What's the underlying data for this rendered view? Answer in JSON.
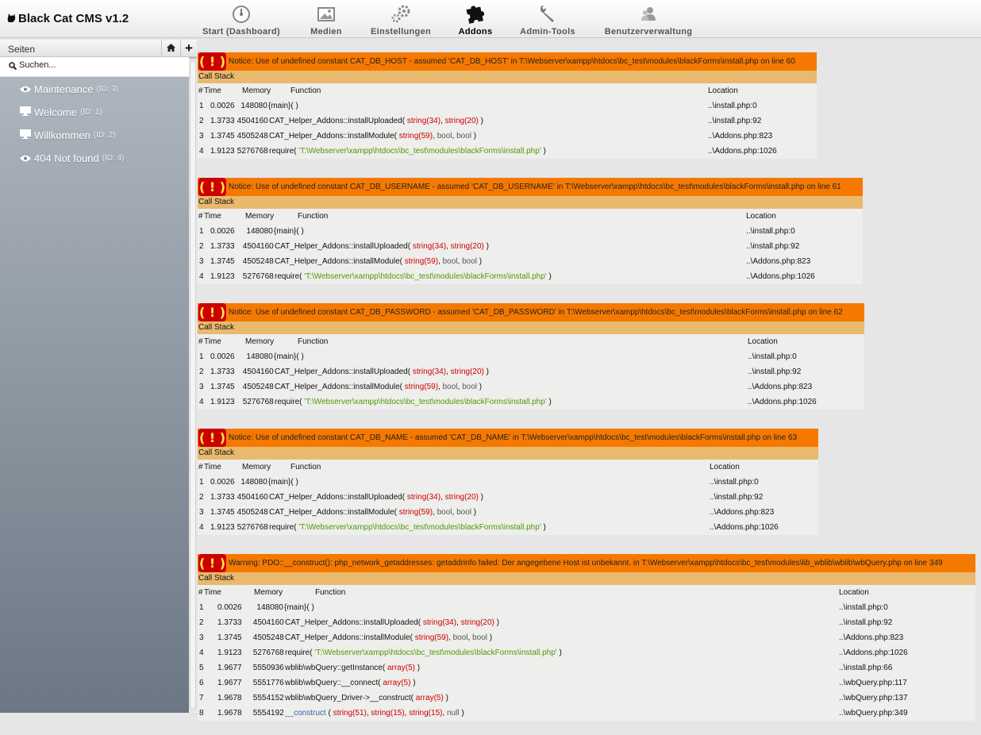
{
  "app": {
    "title": "Black Cat CMS v1.2"
  },
  "nav": [
    {
      "label": "Start (Dashboard)",
      "icon": "dashboard-icon"
    },
    {
      "label": "Medien",
      "icon": "media-icon"
    },
    {
      "label": "Einstellungen",
      "icon": "gears-icon"
    },
    {
      "label": "Addons",
      "icon": "puzzle-icon",
      "active": true
    },
    {
      "label": "Admin-Tools",
      "icon": "wrench-icon"
    },
    {
      "label": "Benutzerverwaltung",
      "icon": "users-icon"
    }
  ],
  "sidebar": {
    "title": "Seiten",
    "search_placeholder": "Suchen...",
    "pages": [
      {
        "name": "Maintenance",
        "id": "(ID: 3)",
        "icon": "eye-icon"
      },
      {
        "name": "Welcome",
        "id": "(ID: 1)",
        "icon": "monitor-icon"
      },
      {
        "name": "Willkommen",
        "id": "(ID: 2)",
        "icon": "monitor-icon"
      },
      {
        "name": "404 Not found",
        "id": "(ID: 4)",
        "icon": "eye-icon"
      }
    ]
  },
  "errors": {
    "call_stack_label": "Call Stack",
    "col_num": "#",
    "col_time": "Time",
    "col_memory": "Memory",
    "col_function": "Function",
    "col_location": "Location",
    "bang": "( ! )",
    "blocks": [
      {
        "message": "Notice: Use of undefined constant CAT_DB_HOST - assumed 'CAT_DB_HOST' in T:\\Webserver\\xampp\\htdocs\\bc_test\\modules\\blackForms\\install.php on line 60",
        "rows": [
          {
            "n": "1",
            "time": "0.0026",
            "mem": "148080",
            "func": "{main}( )",
            "loc": "..\\install.php:0"
          },
          {
            "n": "2",
            "time": "1.3733",
            "mem": "4504160",
            "func": "CAT_Helper_Addons::installUploaded( string(34), string(20) )",
            "loc": "..\\install.php:92"
          },
          {
            "n": "3",
            "time": "1.3745",
            "mem": "4505248",
            "func": "CAT_Helper_Addons::installModule( string(59), bool, bool )",
            "loc": "..\\Addons.php:823"
          },
          {
            "n": "4",
            "time": "1.9123",
            "mem": "5276768",
            "func": "require( 'T:\\Webserver\\xampp\\htdocs\\bc_test\\modules\\blackForms\\install.php' )",
            "loc": "..\\Addons.php:1026"
          }
        ]
      },
      {
        "message": "Notice: Use of undefined constant CAT_DB_USERNAME - assumed 'CAT_DB_USERNAME' in T:\\Webserver\\xampp\\htdocs\\bc_test\\modules\\blackForms\\install.php on line 61",
        "rows": [
          {
            "n": "1",
            "time": "0.0026",
            "mem": "148080",
            "func": "{main}( )",
            "loc": "..\\install.php:0"
          },
          {
            "n": "2",
            "time": "1.3733",
            "mem": "4504160",
            "func": "CAT_Helper_Addons::installUploaded( string(34), string(20) )",
            "loc": "..\\install.php:92"
          },
          {
            "n": "3",
            "time": "1.3745",
            "mem": "4505248",
            "func": "CAT_Helper_Addons::installModule( string(59), bool, bool )",
            "loc": "..\\Addons.php:823"
          },
          {
            "n": "4",
            "time": "1.9123",
            "mem": "5276768",
            "func": "require( 'T:\\Webserver\\xampp\\htdocs\\bc_test\\modules\\blackForms\\install.php' )",
            "loc": "..\\Addons.php:1026"
          }
        ]
      },
      {
        "message": "Notice: Use of undefined constant CAT_DB_PASSWORD - assumed 'CAT_DB_PASSWORD' in T:\\Webserver\\xampp\\htdocs\\bc_test\\modules\\blackForms\\install.php on line 62",
        "rows": [
          {
            "n": "1",
            "time": "0.0026",
            "mem": "148080",
            "func": "{main}( )",
            "loc": "..\\install.php:0"
          },
          {
            "n": "2",
            "time": "1.3733",
            "mem": "4504160",
            "func": "CAT_Helper_Addons::installUploaded( string(34), string(20) )",
            "loc": "..\\install.php:92"
          },
          {
            "n": "3",
            "time": "1.3745",
            "mem": "4505248",
            "func": "CAT_Helper_Addons::installModule( string(59), bool, bool )",
            "loc": "..\\Addons.php:823"
          },
          {
            "n": "4",
            "time": "1.9123",
            "mem": "5276768",
            "func": "require( 'T:\\Webserver\\xampp\\htdocs\\bc_test\\modules\\blackForms\\install.php' )",
            "loc": "..\\Addons.php:1026"
          }
        ]
      },
      {
        "message": "Notice: Use of undefined constant CAT_DB_NAME - assumed 'CAT_DB_NAME' in T:\\Webserver\\xampp\\htdocs\\bc_test\\modules\\blackForms\\install.php on line 63",
        "rows": [
          {
            "n": "1",
            "time": "0.0026",
            "mem": "148080",
            "func": "{main}( )",
            "loc": "..\\install.php:0"
          },
          {
            "n": "2",
            "time": "1.3733",
            "mem": "4504160",
            "func": "CAT_Helper_Addons::installUploaded( string(34), string(20) )",
            "loc": "..\\install.php:92"
          },
          {
            "n": "3",
            "time": "1.3745",
            "mem": "4505248",
            "func": "CAT_Helper_Addons::installModule( string(59), bool, bool )",
            "loc": "..\\Addons.php:823"
          },
          {
            "n": "4",
            "time": "1.9123",
            "mem": "5276768",
            "func": "require( 'T:\\Webserver\\xampp\\htdocs\\bc_test\\modules\\blackForms\\install.php' )",
            "loc": "..\\Addons.php:1026"
          }
        ]
      },
      {
        "message": "Warning: PDO::__construct(): php_network_getaddresses: getaddrinfo failed: Der angegebene Host ist unbekannt. in T:\\Webserver\\xampp\\htdocs\\bc_test\\modules\\lib_wblib\\wblib\\wbQuery.php on line 349",
        "rows": [
          {
            "n": "1",
            "time": "0.0026",
            "mem": "148080",
            "func": "{main}( )",
            "loc": "..\\install.php:0"
          },
          {
            "n": "2",
            "time": "1.3733",
            "mem": "4504160",
            "func": "CAT_Helper_Addons::installUploaded( string(34), string(20) )",
            "loc": "..\\install.php:92"
          },
          {
            "n": "3",
            "time": "1.3745",
            "mem": "4505248",
            "func": "CAT_Helper_Addons::installModule( string(59), bool, bool )",
            "loc": "..\\Addons.php:823"
          },
          {
            "n": "4",
            "time": "1.9123",
            "mem": "5276768",
            "func": "require( 'T:\\Webserver\\xampp\\htdocs\\bc_test\\modules\\blackForms\\install.php' )",
            "loc": "..\\Addons.php:1026"
          },
          {
            "n": "5",
            "time": "1.9677",
            "mem": "5550936",
            "func": "wblib\\wbQuery::getInstance( array(5) )",
            "loc": "..\\install.php:66"
          },
          {
            "n": "6",
            "time": "1.9677",
            "mem": "5551776",
            "func": "wblib\\wbQuery::__connect( array(5) )",
            "loc": "..\\wbQuery.php:117"
          },
          {
            "n": "7",
            "time": "1.9678",
            "mem": "5554152",
            "func": "wblib\\wbQuery_Driver->__construct( array(5) )",
            "loc": "..\\wbQuery.php:137"
          },
          {
            "n": "8",
            "time": "1.9678",
            "mem": "5554192",
            "func": "__construct ( string(51), string(15), string(15), null )",
            "loc": "..\\wbQuery.php:349"
          }
        ]
      }
    ]
  }
}
